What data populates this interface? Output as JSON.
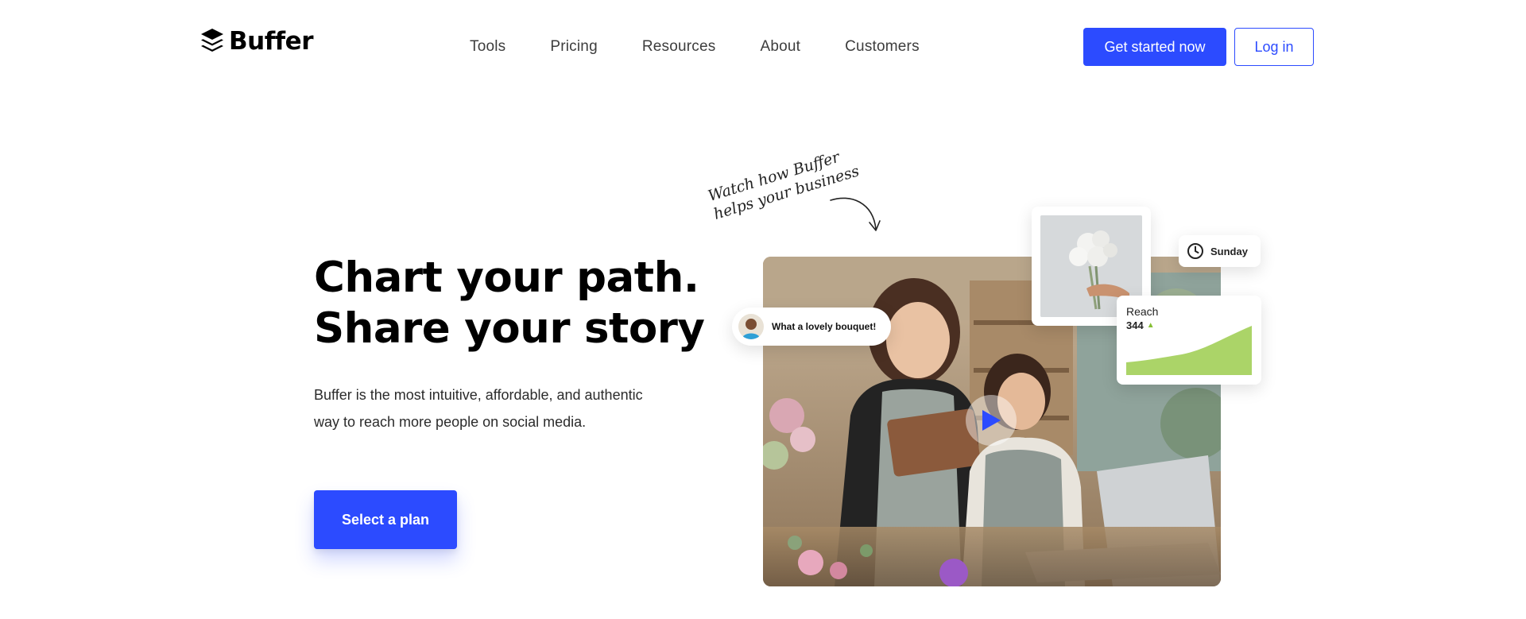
{
  "header": {
    "logo_text": "Buffer",
    "nav": [
      "Tools",
      "Pricing",
      "Resources",
      "About",
      "Customers"
    ],
    "cta_label": "Get started now",
    "login_label": "Log in"
  },
  "hero": {
    "headline_line1": "Chart your path.",
    "headline_line2": "Share your story",
    "subtext": "Buffer is the most intuitive, affordable, and authentic way to reach more people on social media.",
    "button_label": "Select a plan"
  },
  "visual": {
    "handwriting_line1": "Watch how Buffer",
    "handwriting_line2": "helps your business",
    "comment_text": "What a lovely bouquet!",
    "schedule_day": "Sunday",
    "reach_label": "Reach",
    "reach_value": "344"
  },
  "colors": {
    "brand_blue": "#2c4bff",
    "chart_green": "#abd468"
  },
  "icons": [
    "buffer-logo-icon",
    "clock-icon",
    "play-icon",
    "trend-up-icon",
    "curved-arrow-icon"
  ]
}
